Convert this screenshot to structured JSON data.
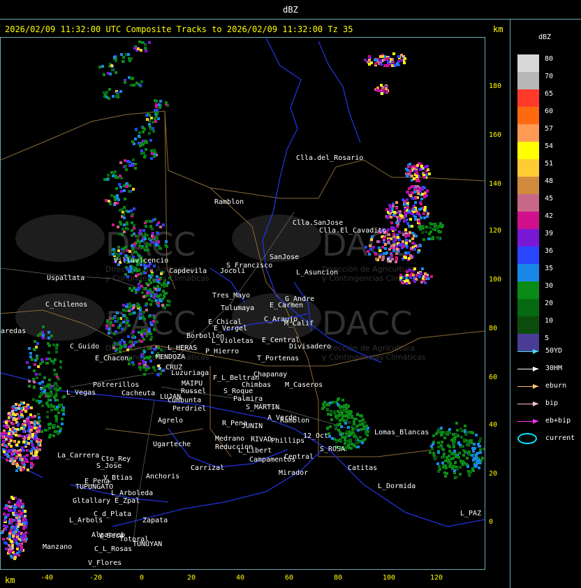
{
  "window_title": "dBZ",
  "header": "2026/02/09 11:32:00 UTC Composite Tracks to 2026/02/09 11:32:00 Tz 35",
  "axis_unit": "km",
  "legend": {
    "title": "dBZ",
    "levels": [
      {
        "label": "80",
        "color": "#d8d8d8"
      },
      {
        "label": "70",
        "color": "#b8b8b8"
      },
      {
        "label": "65",
        "color": "#ff3a2a"
      },
      {
        "label": "60",
        "color": "#ff6a10"
      },
      {
        "label": "57",
        "color": "#ff9a55"
      },
      {
        "label": "54",
        "color": "#ffff00"
      },
      {
        "label": "51",
        "color": "#ffcc33"
      },
      {
        "label": "48",
        "color": "#d08c3c"
      },
      {
        "label": "45",
        "color": "#c86888"
      },
      {
        "label": "42",
        "color": "#d0108c"
      },
      {
        "label": "39",
        "color": "#7a18d8"
      },
      {
        "label": "36",
        "color": "#2a46ff"
      },
      {
        "label": "35",
        "color": "#1888e8"
      },
      {
        "label": "30",
        "color": "#0a8a16"
      },
      {
        "label": "20",
        "color": "#056a12"
      },
      {
        "label": "10",
        "color": "#0c4c0c"
      },
      {
        "label": "5",
        "color": "#483c94"
      }
    ],
    "tracks": [
      {
        "label": "50YD",
        "color": "#44e0e0"
      },
      {
        "label": "30HM",
        "color": "#ffffff"
      },
      {
        "label": "eburn",
        "color": "#ffc070"
      },
      {
        "label": "bip",
        "color": "#ffc0d8"
      },
      {
        "label": "eb+bip",
        "color": "#ff30ff"
      }
    ],
    "current_label": "current"
  },
  "y_ticks": [
    "180",
    "160",
    "140",
    "120",
    "100",
    "80",
    "60",
    "40",
    "20",
    "0"
  ],
  "x_ticks": [
    "-40",
    "-20",
    "0",
    "20",
    "40",
    "60",
    "80",
    "100",
    "120"
  ],
  "watermark": {
    "brand": "DACC",
    "line1": "Dirección de Agricultura",
    "line2": "y Contingencias Climáticas"
  },
  "places": [
    {
      "name": "Clla.del_Rosario"
    },
    {
      "name": "Ramblon"
    },
    {
      "name": "Clla.SanJose"
    },
    {
      "name": "Clla.El_Cavadito"
    },
    {
      "name": "Villavicencio"
    },
    {
      "name": "Capdevila"
    },
    {
      "name": "Jocoli"
    },
    {
      "name": "S_Francisco"
    },
    {
      "name": "SanJose"
    },
    {
      "name": "L_Asuncion"
    },
    {
      "name": "Uspallata"
    },
    {
      "name": "C_Chilenos"
    },
    {
      "name": "Tres_Mayo"
    },
    {
      "name": "Tulumaya"
    },
    {
      "name": "E_Carmen"
    },
    {
      "name": "G_Andre"
    },
    {
      "name": "E_Chical"
    },
    {
      "name": "E_Vergel"
    },
    {
      "name": "C_Araujo"
    },
    {
      "name": "M_Calif"
    },
    {
      "name": "Borbollon"
    },
    {
      "name": "L_Violetas"
    },
    {
      "name": "E_Central"
    },
    {
      "name": "Divisadero"
    },
    {
      "name": "C_Guido"
    },
    {
      "name": "L_HERAS"
    },
    {
      "name": "P_Hierro"
    },
    {
      "name": "E_Chacon"
    },
    {
      "name": "MENDOZA"
    },
    {
      "name": "T_Portenas"
    },
    {
      "name": "S_CRUZ"
    },
    {
      "name": "Luzuriaga"
    },
    {
      "name": "F_L_Beltran"
    },
    {
      "name": "Chapanay"
    },
    {
      "name": "Potrerillos"
    },
    {
      "name": "Cacheuta"
    },
    {
      "name": "MAIPU"
    },
    {
      "name": "Chimbas"
    },
    {
      "name": "M_Caseros"
    },
    {
      "name": "L_Vegas"
    },
    {
      "name": "Russel"
    },
    {
      "name": "S_Roque"
    },
    {
      "name": "LUJAN"
    },
    {
      "name": "Cumbunta"
    },
    {
      "name": "Palmira"
    },
    {
      "name": "S_MARTIN"
    },
    {
      "name": "Perdriel"
    },
    {
      "name": "A_Verde"
    },
    {
      "name": "Ramblon"
    },
    {
      "name": "Agrelo"
    },
    {
      "name": "R_Pena"
    },
    {
      "name": "JUNIN"
    },
    {
      "name": "Lomas_Blancas"
    },
    {
      "name": "Ugarteche"
    },
    {
      "name": "12_Oct"
    },
    {
      "name": "Medrano"
    },
    {
      "name": "RIVAD"
    },
    {
      "name": "Phillips"
    },
    {
      "name": "Reduccion"
    },
    {
      "name": "L_Libert"
    },
    {
      "name": "S_ROSA"
    },
    {
      "name": "La_Carrera"
    },
    {
      "name": "Cto_Rey"
    },
    {
      "name": "S_Jose"
    },
    {
      "name": "Campamentos"
    },
    {
      "name": "Central"
    },
    {
      "name": "Catitas"
    },
    {
      "name": "Carrizal"
    },
    {
      "name": "V_Btias"
    },
    {
      "name": "Anchoris"
    },
    {
      "name": "E_Pena"
    },
    {
      "name": "TUPUNGATO"
    },
    {
      "name": "Mirador"
    },
    {
      "name": "L_Dormida"
    },
    {
      "name": "L_Arboleda"
    },
    {
      "name": "Gltallary"
    },
    {
      "name": "E_Zpal"
    },
    {
      "name": "C_d_Plata"
    },
    {
      "name": "Zapata"
    },
    {
      "name": "L_Arbols"
    },
    {
      "name": "Algarrob"
    },
    {
      "name": "V_Seca"
    },
    {
      "name": "Totoral"
    },
    {
      "name": "TUNUYAN"
    },
    {
      "name": "L_PAZ"
    },
    {
      "name": "Manzano"
    },
    {
      "name": "C_L_Rosas"
    },
    {
      "name": "V_Flores"
    },
    {
      "name": "aredas"
    }
  ]
}
